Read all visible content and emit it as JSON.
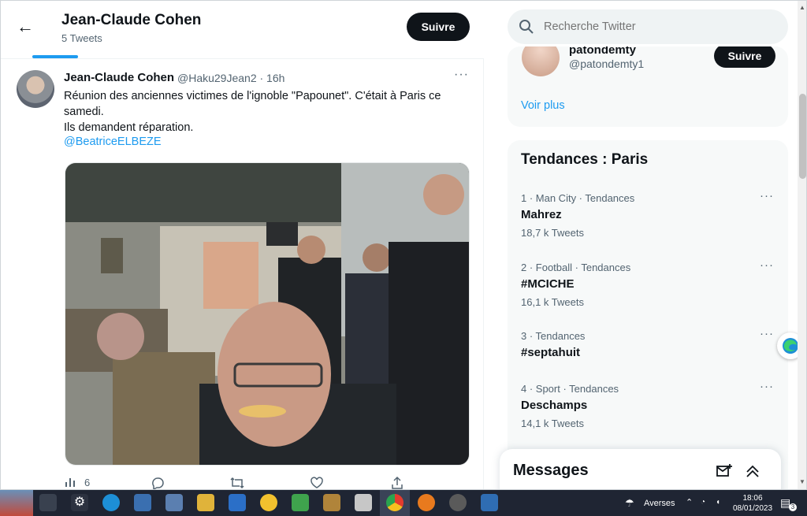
{
  "header": {
    "title": "Jean-Claude Cohen",
    "subtitle": "5 Tweets",
    "follow_label": "Suivre"
  },
  "tweet": {
    "author_name": "Jean-Claude Cohen",
    "author_meta": "@Haku29Jean2 · 16h",
    "more": "···",
    "text": "Réunion des anciennes victimes de l'ignoble \"Papounet\". C'était à Paris ce samedi.\nIls demandent réparation.",
    "mention": "@BeatriceELBEZE",
    "views": "6"
  },
  "search": {
    "placeholder": "Recherche Twitter"
  },
  "suggestion": {
    "name": "patondemty",
    "handle": "@patondemty1",
    "follow_label": "Suivre",
    "show_more": "Voir plus"
  },
  "trends": {
    "title": "Tendances : Paris",
    "items": [
      {
        "meta": "1 · Man City · Tendances",
        "name": "Mahrez",
        "count": "18,7 k Tweets"
      },
      {
        "meta": "2 · Football · Tendances",
        "name": "#MCICHE",
        "count": "16,1 k Tweets"
      },
      {
        "meta": "3 · Tendances",
        "name": "#septahuit",
        "count": ""
      },
      {
        "meta": "4 · Sport · Tendances",
        "name": "Deschamps",
        "count": "14,1 k Tweets"
      }
    ]
  },
  "messages": {
    "title": "Messages"
  },
  "taskbar": {
    "weather": "Averses",
    "time": "18:06",
    "date": "08/01/2023",
    "notifications": "3"
  },
  "colors": {
    "accent": "#1d9bf0",
    "text": "#0f1419",
    "muted": "#536471"
  }
}
